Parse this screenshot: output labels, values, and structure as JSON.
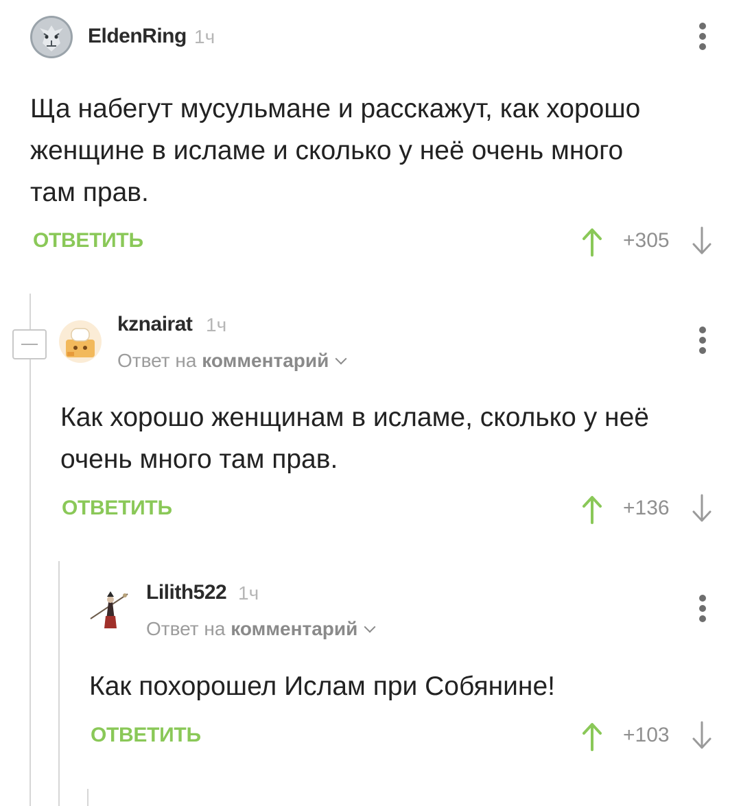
{
  "comments": [
    {
      "username": "EldenRing",
      "time": "1ч",
      "lines": [
        "Ща набегут мусульмане и расскажут, как хорошо",
        "женщине в исламе и сколько у неё очень много",
        "там прав."
      ],
      "reply_label": "ОТВЕТИТЬ",
      "score": "+305"
    },
    {
      "username": "kznairat",
      "time": "1ч",
      "reply_prefix": "Ответ на",
      "reply_target": "комментарий",
      "lines": [
        "Как хорошо женщинам в исламе, сколько у неё",
        "очень много там прав."
      ],
      "reply_label": "ОТВЕТИТЬ",
      "score": "+136"
    },
    {
      "username": "Lilith522",
      "time": "1ч",
      "reply_prefix": "Ответ на",
      "reply_target": "комментарий",
      "lines": [
        "Как похорошел Ислам при Собянине!"
      ],
      "reply_label": "ОТВЕТИТЬ",
      "score": "+103"
    }
  ],
  "colors": {
    "accent_green": "#8ac858",
    "arrow_gray": "#9a9a9a",
    "thread_line": "#d6d6d6"
  }
}
